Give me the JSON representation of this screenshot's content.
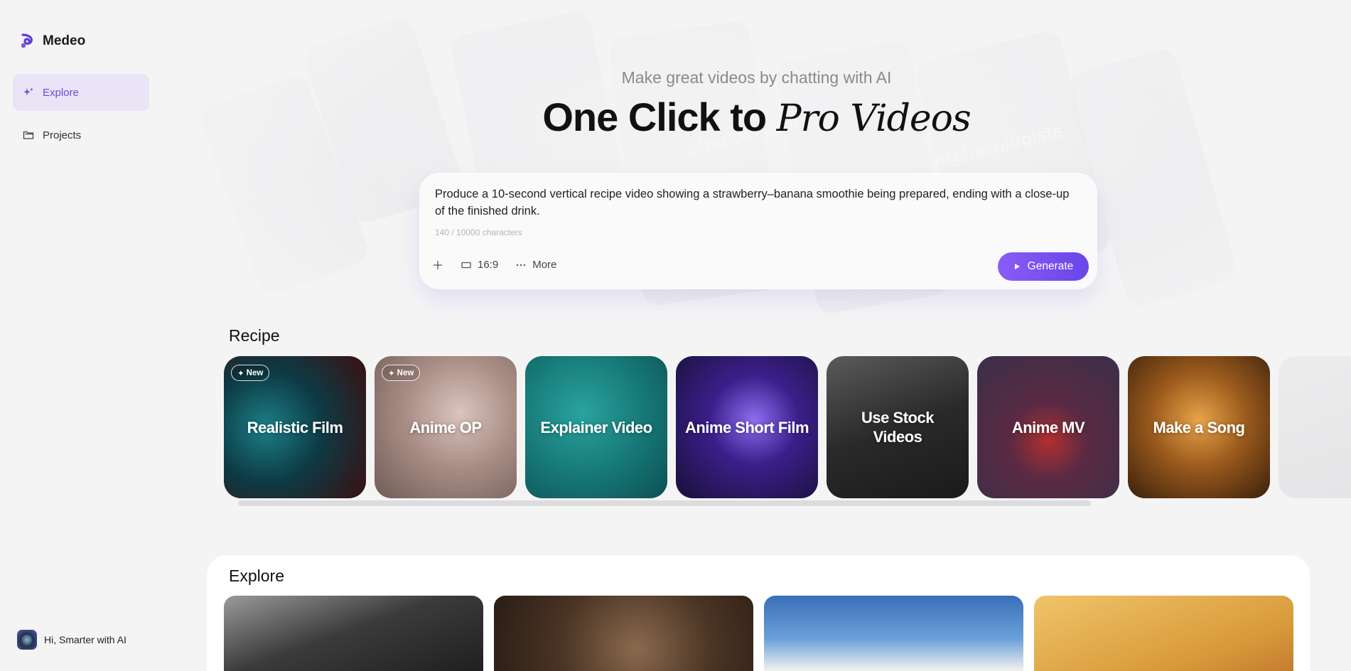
{
  "app": {
    "name": "Medeo"
  },
  "sidebar": {
    "items": [
      {
        "label": "Explore",
        "icon": "sparkle-icon",
        "active": true
      },
      {
        "label": "Projects",
        "icon": "folder-icon",
        "active": false
      }
    ],
    "user_greeting": "Hi, Smarter with AI"
  },
  "hero": {
    "subtitle": "Make great videos by chatting with AI",
    "headline_bold": "One Click to",
    "headline_italic": "Pro Videos"
  },
  "prompt": {
    "text": "Produce a 10-second vertical recipe video showing a strawberry–banana smoothie being prepared, ending with a close-up of the finished drink.",
    "char_count": "140 / 10000 characters",
    "aspect_ratio": "16:9",
    "more_label": "More",
    "generate_label": "Generate"
  },
  "recipe": {
    "title": "Recipe",
    "new_badge": "New",
    "cards": [
      {
        "label": "Realistic Film",
        "new": true
      },
      {
        "label": "Anime OP",
        "new": true
      },
      {
        "label": "Explainer Video",
        "new": false
      },
      {
        "label": "Anime Short Film",
        "new": false
      },
      {
        "label": "Use Stock Videos",
        "new": false
      },
      {
        "label": "Anime MV",
        "new": false
      },
      {
        "label": "Make a Song",
        "new": false
      }
    ]
  },
  "explore": {
    "title": "Explore"
  },
  "colors": {
    "accent": "#7c52f0",
    "active_bg": "#e9e4f6"
  }
}
